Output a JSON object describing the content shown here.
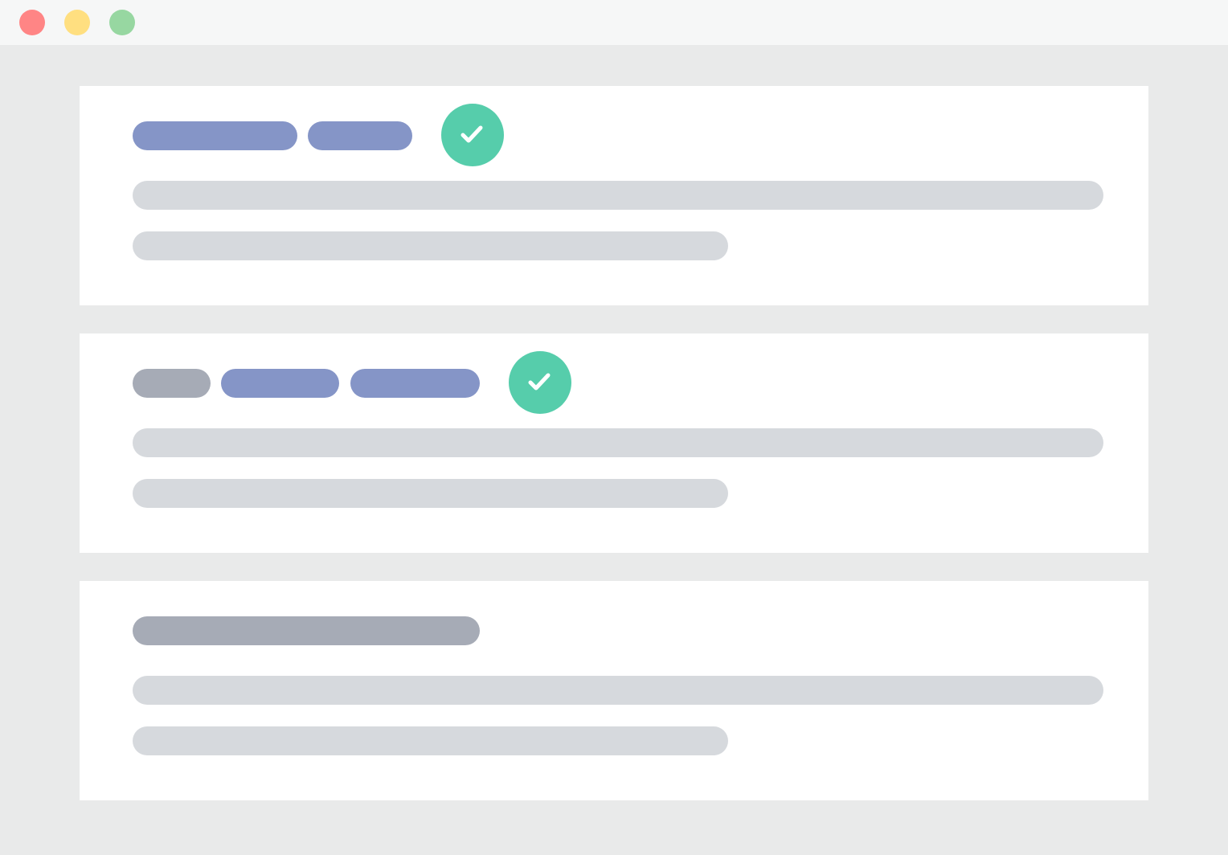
{
  "window": {
    "controls": [
      {
        "name": "close",
        "color": "#ff8585"
      },
      {
        "name": "minimize",
        "color": "#ffdf80"
      },
      {
        "name": "maximize",
        "color": "#97d7a1"
      }
    ]
  },
  "colors": {
    "background": "#e9eaea",
    "titlebar": "#f6f7f7",
    "card": "#ffffff",
    "tag_primary": "#8595c7",
    "tag_muted": "#a6abb6",
    "text_placeholder": "#d6d9dd",
    "check_badge": "#56cdab",
    "check_mark": "#ffffff"
  },
  "cards": [
    {
      "tags": [
        "primary",
        "primary"
      ],
      "verified": true,
      "lines": 2
    },
    {
      "tags": [
        "muted",
        "primary",
        "primary"
      ],
      "verified": true,
      "lines": 2
    },
    {
      "tags": [
        "muted"
      ],
      "verified": false,
      "lines": 2
    }
  ],
  "icons": {
    "check": "check-circle-icon"
  }
}
